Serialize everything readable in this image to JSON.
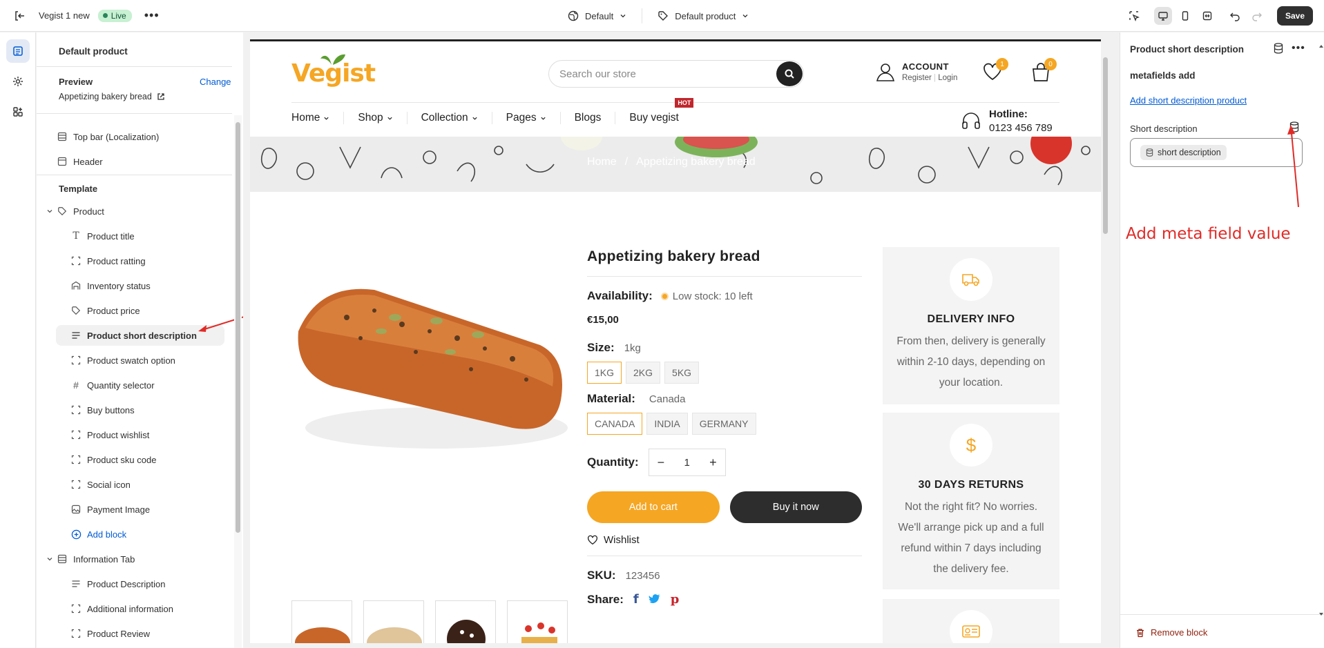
{
  "topbar": {
    "theme_name": "Vegist 1 new",
    "live_label": "Live",
    "more": "•••",
    "template_selector": "Default",
    "product_selector": "Default product",
    "save_label": "Save"
  },
  "sidebar": {
    "title": "Default product",
    "preview_label": "Preview",
    "change_label": "Change",
    "preview_value": "Appetizing bakery bread",
    "items": {
      "top_bar": "Top bar (Localization)",
      "header": "Header",
      "template": "Template",
      "product": "Product",
      "product_title": "Product title",
      "product_ratting": "Product ratting",
      "inventory_status": "Inventory status",
      "product_price": "Product price",
      "product_short_description": "Product short description",
      "product_swatch_option": "Product swatch option",
      "quantity_selector": "Quantity selector",
      "buy_buttons": "Buy buttons",
      "product_wishlist": "Product wishlist",
      "product_sku_code": "Product sku code",
      "social_icon": "Social icon",
      "payment_image": "Payment Image",
      "add_block": "Add block",
      "information_tab": "Information Tab",
      "product_description": "Product Description",
      "additional_information": "Additional information",
      "product_review": "Product Review"
    }
  },
  "store": {
    "logo": "Vegist",
    "search_placeholder": "Search our store",
    "account_title": "ACCOUNT",
    "account_register": "Register",
    "account_login": "Login",
    "wishlist_count": "1",
    "cart_count": "0",
    "nav": [
      "Home",
      "Shop",
      "Collection",
      "Pages",
      "Blogs",
      "Buy vegist"
    ],
    "hot_badge": "HOT",
    "hotline_label": "Hotline:",
    "hotline_value": "0123 456 789",
    "breadcrumb_home": "Home",
    "breadcrumb_sep": "/",
    "breadcrumb_current": "Appetizing bakery bread"
  },
  "product": {
    "title": "Appetizing bakery bread",
    "availability_label": "Availability:",
    "availability_value": "Low stock: 10 left",
    "price": "€15,00",
    "size_label": "Size:",
    "size_value": "1kg",
    "sizes": [
      "1KG",
      "2KG",
      "5KG"
    ],
    "material_label": "Material:",
    "material_value": "Canada",
    "materials": [
      "CANADA",
      "INDIA",
      "GERMANY"
    ],
    "quantity_label": "Quantity:",
    "quantity_value": "1",
    "add_to_cart": "Add to cart",
    "buy_now": "Buy it now",
    "wishlist": "Wishlist",
    "sku_label": "SKU:",
    "sku_value": "123456",
    "share_label": "Share:"
  },
  "services": [
    {
      "title": "DELIVERY INFO",
      "desc": "From then, delivery is generally within 2-10 days, depending on your location."
    },
    {
      "title": "30 DAYS RETURNS",
      "desc": "Not the right fit? No worries. We'll arrange pick up and a full refund within 7 days including the delivery fee."
    }
  ],
  "right_panel": {
    "title": "Product short description",
    "subtitle": "metafields add",
    "link": "Add short description product",
    "field_label": "Short description",
    "chip": "short description",
    "remove": "Remove block"
  },
  "annotation": "Add meta field value",
  "colors": {
    "accent": "#f5a623",
    "annotation": "#e02b27",
    "link": "#005bd3"
  }
}
